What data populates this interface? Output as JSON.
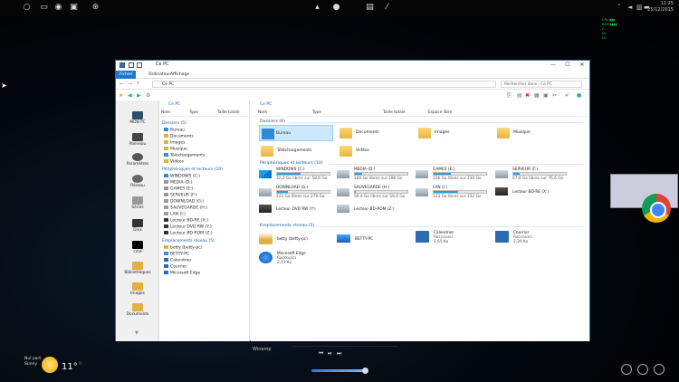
{
  "topbar": {
    "icons": [
      "circle-icon",
      "monitor-icon",
      "camera-icon",
      "radio-icon",
      "steam-icon"
    ],
    "center_icons": [
      "bar-icon",
      "globe-icon",
      "menu-icon",
      "pen-icon"
    ],
    "time": "11:25",
    "date": "25/12/2015"
  },
  "sysmon": {
    "lines": [
      "CPU ▮▮▮",
      "RAM ▮▮▮▮",
      "C:",
      "DL",
      "UL"
    ]
  },
  "window": {
    "title": "Ce PC",
    "ribbon_tabs": [
      "Fichier",
      "Ordinateur",
      "Affichage"
    ],
    "address": "Ce PC",
    "search_placeholder": "Rechercher dans : Ce PC",
    "minimize": "—",
    "maximize": "☐",
    "close": "✕"
  },
  "strip": {
    "items": [
      {
        "label": "MON PC",
        "color": "#2f4f6f"
      },
      {
        "label": "Panneau",
        "color": "#444"
      },
      {
        "label": "Paramètres",
        "color": "#555"
      },
      {
        "label": "Réseau",
        "color": "#666"
      },
      {
        "label": "Séries",
        "color": "#999"
      },
      {
        "label": "Divx",
        "color": "#333"
      },
      {
        "label": "cmd",
        "color": "#000"
      },
      {
        "label": "Bibliothèques",
        "color": "#e0b040"
      },
      {
        "label": "Images",
        "color": "#e0b040"
      },
      {
        "label": "Documents",
        "color": "#e0b040"
      }
    ]
  },
  "navpane": {
    "tab": "Ce PC",
    "headers": [
      "Nom",
      "Type",
      "Taille totale"
    ],
    "groups": [
      {
        "label": "Dossiers (5)",
        "items": [
          "Bureau",
          "Documents",
          "Images",
          "Musique",
          "Téléchargements",
          "Vidéos"
        ]
      },
      {
        "label": "Périphériques et lecteurs (10)",
        "items": [
          "WINDOWS (C:)",
          "MEDIA (D:)",
          "GAMES (E:)",
          "SERVEUR (F:)",
          "DOWNLOAD (G:)",
          "SAUVEGARDE (H:)",
          "LAN (I:)",
          "Lecteur BD-RE (X:)",
          "Lecteur DVD RW (Y:)",
          "Lecteur BD-ROM (Z:)"
        ]
      },
      {
        "label": "Emplacements réseau (5)",
        "items": [
          "betty (betty-pc)",
          "BETTY-PC",
          "Calendrier",
          "Courrier",
          "Microsoft Edge"
        ]
      }
    ]
  },
  "content": {
    "tab": "Ce PC",
    "headers": [
      "Nom",
      "Type",
      "Taille totale",
      "Espace libre"
    ],
    "folders_header": "Dossiers (6)",
    "folders": [
      "Bureau",
      "Documents",
      "Images",
      "Musique",
      "Téléchargements",
      "Vidéos"
    ],
    "drives_header": "Périphériques et lecteurs (10)",
    "drives": [
      {
        "name": "WINDOWS (C:)",
        "free": "32,2 Go libres sur 58,6 Go",
        "used": 0.45,
        "red": false
      },
      {
        "name": "MEDIA (D:)",
        "free": "160 Go libres sur 186 Go",
        "used": 0.14,
        "red": false
      },
      {
        "name": "GAMES (E:)",
        "free": "156 Go libres sur 230 Go",
        "used": 0.32,
        "red": false
      },
      {
        "name": "SERVEUR (F:)",
        "free": "67,6 Go libres sur 76,6 Go",
        "used": 0.12,
        "red": false
      },
      {
        "name": "DOWNLOAD (G:)",
        "free": "222 Go libres sur 279 Go",
        "used": 0.2,
        "red": false
      },
      {
        "name": "SAUVEGARDE (H:)",
        "free": "58,4 Go libres sur 58,6 Go",
        "used": 0.02,
        "red": false
      },
      {
        "name": "LAN (I:)",
        "free": "123 Go libres sur 232 Go",
        "used": 0.47,
        "red": false
      },
      {
        "name": "Lecteur BD-RE (X:)",
        "free": "",
        "used": null,
        "red": false
      },
      {
        "name": "Lecteur DVD RW (Y:)",
        "free": "",
        "used": null,
        "red": false
      },
      {
        "name": "Lecteur BD-ROM (Z:)",
        "free": "",
        "used": null,
        "red": false
      }
    ],
    "net_header": "Emplacements réseau (5)",
    "network": [
      {
        "name": "betty (betty-pc)",
        "sub": ""
      },
      {
        "name": "BETTY-PC",
        "sub": ""
      },
      {
        "name": "Calendrier",
        "sub": "Raccourci",
        "size": "2,65 Ko"
      },
      {
        "name": "Courrier",
        "sub": "Raccourci",
        "size": "2,36 Ko"
      },
      {
        "name": "Microsoft Edge",
        "sub": "Raccourci",
        "size": "2,43 Ko"
      }
    ]
  },
  "weather": {
    "place": "Nul part",
    "sky": "Sunny",
    "temp": "11°"
  },
  "player": {
    "title": "Winamp"
  }
}
